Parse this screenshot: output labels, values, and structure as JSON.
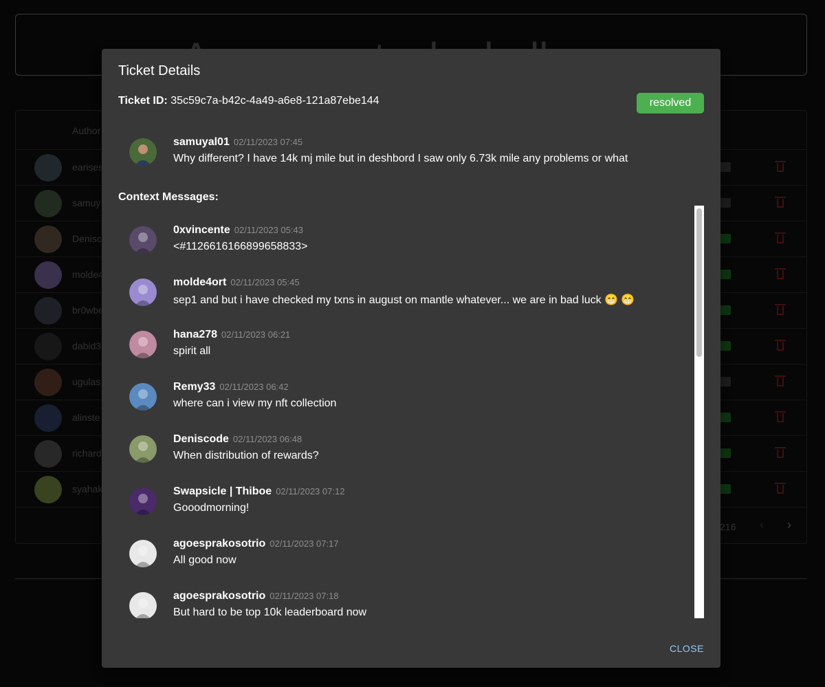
{
  "page": {
    "title": "Awesome tech challenge",
    "table": {
      "author_header": "Author",
      "rows": [
        {
          "name": "earises",
          "color": "#3c4a52",
          "status_color": "#333333"
        },
        {
          "name": "samuy",
          "color": "#3f4f3a",
          "status_color": "#333333"
        },
        {
          "name": "Denisc",
          "color": "#5a4a3a",
          "status_color": "#1b5e20"
        },
        {
          "name": "molde4",
          "color": "#6a5a8a",
          "status_color": "#1b5e20"
        },
        {
          "name": "br0wbe",
          "color": "#3a3a4a",
          "status_color": "#1b5e20"
        },
        {
          "name": "dabid3",
          "color": "#2a2a2a",
          "status_color": "#1b5e20"
        },
        {
          "name": "ugulas",
          "color": "#5a3a2a",
          "status_color": "#333333"
        },
        {
          "name": "alinste",
          "color": "#2a3a5a",
          "status_color": "#1b5e20"
        },
        {
          "name": "richard",
          "color": "#4a4a4a",
          "status_color": "#1b5e20"
        },
        {
          "name": "syahak",
          "color": "#6a7a3a",
          "status_color": "#1b5e20"
        }
      ],
      "pager_count": "216",
      "prev_icon": "chevron-left",
      "next_icon": "chevron-right"
    }
  },
  "dialog": {
    "title": "Ticket Details",
    "ticket_label": "Ticket ID:",
    "ticket_id": "35c59c7a-b42c-4a49-a6e8-121a87ebe144",
    "status": "resolved",
    "status_color": "#4caf50",
    "main_message": {
      "author": "samuyal01",
      "time": "02/11/2023 07:45",
      "text": "Why different? I have 14k mj mile but in deshbord I saw only 6.73k mile any problems or what",
      "avatar_color": "#4a6a3a"
    },
    "context_label": "Context Messages:",
    "context_messages": [
      {
        "author": "0xvincente",
        "time": "02/11/2023 05:43",
        "text": "<#1126616166899658833>",
        "avatar_color": "#5a4a6a"
      },
      {
        "author": "molde4ort",
        "time": "02/11/2023 05:45",
        "text": "sep1 and but i have checked my txns in august on mantle whatever... we are in bad luck 😁 😁",
        "avatar_color": "#9a8ad0"
      },
      {
        "author": "hana278",
        "time": "02/11/2023 06:21",
        "text": "spirit all",
        "avatar_color": "#c08aa0"
      },
      {
        "author": "Remy33",
        "time": "02/11/2023 06:42",
        "text": "where can i view my nft collection",
        "avatar_color": "#5a8ac0"
      },
      {
        "author": "Deniscode",
        "time": "02/11/2023 06:48",
        "text": "When distribution of rewards?",
        "avatar_color": "#8a9a6a"
      },
      {
        "author": "Swapsicle | Thiboe",
        "time": "02/11/2023 07:12",
        "text": "Gooodmorning!",
        "avatar_color": "#4a2a6a"
      },
      {
        "author": "agoesprakosotrio",
        "time": "02/11/2023 07:17",
        "text": "All good now",
        "avatar_color": "#e8e8e8"
      },
      {
        "author": "agoesprakosotrio",
        "time": "02/11/2023 07:18",
        "text": "But hard to be top 10k leaderboard now",
        "avatar_color": "#e8e8e8"
      }
    ],
    "close_label": "CLOSE"
  }
}
